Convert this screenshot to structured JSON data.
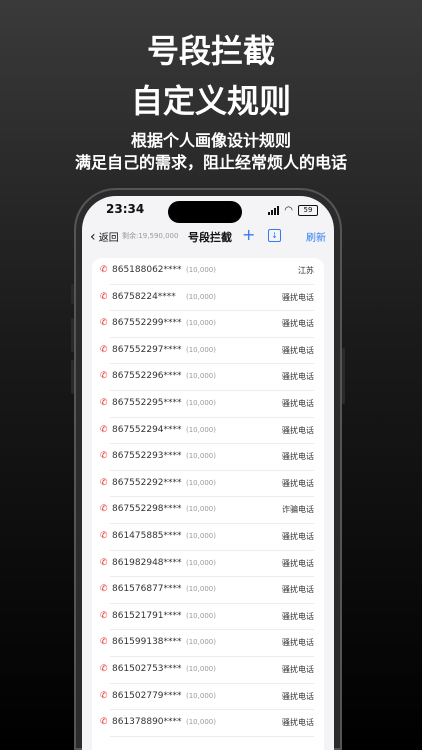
{
  "hero": {
    "title_line1": "号段拦截",
    "title_line2": "自定义规则",
    "sub1": "根据个人画像设计规则",
    "sub2": "满足自己的需求，阻止经常烦人的电话"
  },
  "status": {
    "time": "23:34",
    "battery": "59"
  },
  "nav": {
    "back_label": "返回",
    "remaining": "剩余:19,590,000",
    "title": "号段拦截",
    "add": "+",
    "download": "↓",
    "refresh": "刷新"
  },
  "rows": [
    {
      "number": "865188062****",
      "count": "(10,000)",
      "category": "江苏"
    },
    {
      "number": "86758224****",
      "count": "(10,000)",
      "category": "骚扰电话"
    },
    {
      "number": "867552299****",
      "count": "(10,000)",
      "category": "骚扰电话"
    },
    {
      "number": "867552297****",
      "count": "(10,000)",
      "category": "骚扰电话"
    },
    {
      "number": "867552296****",
      "count": "(10,000)",
      "category": "骚扰电话"
    },
    {
      "number": "867552295****",
      "count": "(10,000)",
      "category": "骚扰电话"
    },
    {
      "number": "867552294****",
      "count": "(10,000)",
      "category": "骚扰电话"
    },
    {
      "number": "867552293****",
      "count": "(10,000)",
      "category": "骚扰电话"
    },
    {
      "number": "867552292****",
      "count": "(10,000)",
      "category": "骚扰电话"
    },
    {
      "number": "867552298****",
      "count": "(10,000)",
      "category": "诈骗电话"
    },
    {
      "number": "861475885****",
      "count": "(10,000)",
      "category": "骚扰电话"
    },
    {
      "number": "861982948****",
      "count": "(10,000)",
      "category": "骚扰电话"
    },
    {
      "number": "861576877****",
      "count": "(10,000)",
      "category": "骚扰电话"
    },
    {
      "number": "861521791****",
      "count": "(10,000)",
      "category": "骚扰电话"
    },
    {
      "number": "861599138****",
      "count": "(10,000)",
      "category": "骚扰电话"
    },
    {
      "number": "861502753****",
      "count": "(10,000)",
      "category": "骚扰电话"
    },
    {
      "number": "861502779****",
      "count": "(10,000)",
      "category": "骚扰电话"
    },
    {
      "number": "861378890****",
      "count": "(10,000)",
      "category": "骚扰电话"
    }
  ],
  "colors": {
    "accent": "#2f7cf6",
    "phone_icon": "#e53935"
  },
  "icons": {
    "phone": "phone-icon",
    "back": "chevron-left-icon",
    "download": "download-icon"
  }
}
